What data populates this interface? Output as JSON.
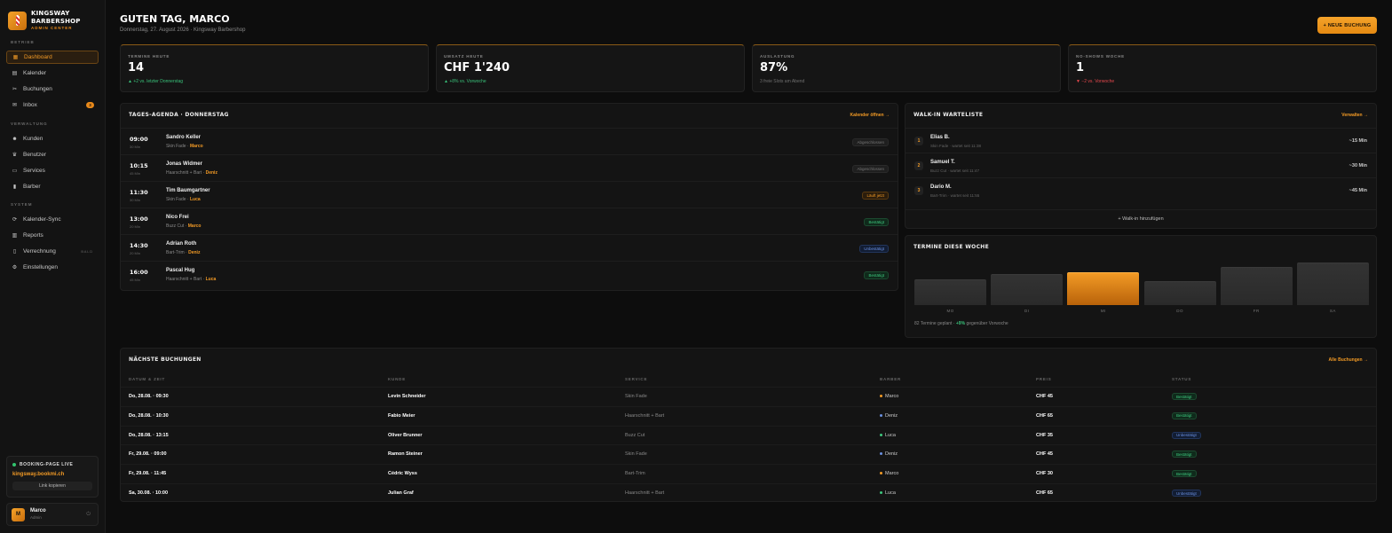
{
  "brand": {
    "name_line1": "KINGSWAY",
    "name_line2": "BARBERSHOP",
    "sub": "ADMIN CENTER"
  },
  "sidebar": {
    "sections": [
      {
        "label": "BETRIEB",
        "items": [
          {
            "label": "Dashboard",
            "icon": "grid-icon",
            "glyph": "▦",
            "active": true
          },
          {
            "label": "Kalender",
            "icon": "calendar-icon",
            "glyph": "▤"
          },
          {
            "label": "Buchungen",
            "icon": "scissors-icon",
            "glyph": "✂"
          },
          {
            "label": "Inbox",
            "icon": "inbox-icon",
            "glyph": "✉",
            "badge": "3"
          }
        ]
      },
      {
        "label": "VERWALTUNG",
        "items": [
          {
            "label": "Kunden",
            "icon": "user-icon",
            "glyph": "☻"
          },
          {
            "label": "Benutzer",
            "icon": "trophy-icon",
            "glyph": "♛"
          },
          {
            "label": "Services",
            "icon": "ticket-icon",
            "glyph": "▭"
          },
          {
            "label": "Barber",
            "icon": "barber-pole-icon",
            "glyph": "▮"
          }
        ]
      },
      {
        "label": "SYSTEM",
        "items": [
          {
            "label": "Kalender-Sync",
            "icon": "sync-icon",
            "glyph": "⟳"
          },
          {
            "label": "Reports",
            "icon": "chart-icon",
            "glyph": "▥"
          },
          {
            "label": "Verrechnung",
            "icon": "invoice-icon",
            "glyph": "▯",
            "tag": "BALD"
          },
          {
            "label": "Einstellungen",
            "icon": "gear-icon",
            "glyph": "⚙"
          }
        ]
      }
    ],
    "live": {
      "title": "BOOKING-PAGE LIVE",
      "url": "kingsway.bookmi.ch",
      "button": "Link kopieren"
    },
    "user": {
      "initial": "M",
      "name": "Marco",
      "role": "Admin"
    }
  },
  "header": {
    "greeting": "GUTEN TAG, MARCO",
    "subtitle": "Donnerstag, 27. August 2026 · Kingsway Barbershop",
    "new_button": "+ NEUE BUCHUNG"
  },
  "kpis": [
    {
      "label": "TERMINE HEUTE",
      "value": "14",
      "trend": "▲ +2 vs. letzter Donnerstag",
      "kind": "up"
    },
    {
      "label": "UMSATZ HEUTE",
      "value": "CHF 1'240",
      "trend": "▲ +8% vs. Vorwoche",
      "kind": "up"
    },
    {
      "label": "AUSLASTUNG",
      "value": "87%",
      "trend": "3 freie Slots am Abend",
      "kind": "muted"
    },
    {
      "label": "NO-SHOWS WOCHE",
      "value": "1",
      "trend": "▼ −2 vs. Vorwoche",
      "kind": "down"
    }
  ],
  "agenda": {
    "title": "TAGES-AGENDA · DONNERSTAG",
    "link": "Kalender öffnen →",
    "rows": [
      {
        "time": "09:00",
        "dur": "30 Min",
        "name": "Sandro Keller",
        "service": "Skin Fade",
        "barber": "Marco",
        "status": "Abgeschlossen",
        "kind": "done"
      },
      {
        "time": "10:15",
        "dur": "45 Min",
        "name": "Jonas Widmer",
        "service": "Haarschnitt + Bart",
        "barber": "Deniz",
        "status": "Abgeschlossen",
        "kind": "done"
      },
      {
        "time": "11:30",
        "dur": "30 Min",
        "name": "Tim Baumgartner",
        "service": "Skin Fade",
        "barber": "Luca",
        "status": "Läuft jetzt",
        "kind": "run"
      },
      {
        "time": "13:00",
        "dur": "20 Min",
        "name": "Nico Frei",
        "service": "Buzz Cut",
        "barber": "Marco",
        "status": "Bestätigt",
        "kind": "ok"
      },
      {
        "time": "14:30",
        "dur": "20 Min",
        "name": "Adrian Roth",
        "service": "Bart-Trim",
        "barber": "Deniz",
        "status": "Unbestätigt",
        "kind": "pend"
      },
      {
        "time": "16:00",
        "dur": "45 Min",
        "name": "Pascal Hug",
        "service": "Haarschnitt + Bart",
        "barber": "Luca",
        "status": "Bestätigt",
        "kind": "ok"
      }
    ]
  },
  "walkin": {
    "title": "WALK-IN WARTELISTE",
    "link": "Verwalten →",
    "rows": [
      {
        "num": "1",
        "name": "Elias B.",
        "sub": "Skin Fade · wartet seit 11:38",
        "wait": "~15 Min"
      },
      {
        "num": "2",
        "name": "Samuel T.",
        "sub": "Buzz Cut · wartet seit 11:47",
        "wait": "~30 Min"
      },
      {
        "num": "3",
        "name": "Dario M.",
        "sub": "Bart-Trim · wartet seit 11:55",
        "wait": "~45 Min"
      }
    ],
    "add": "+ Walk-in hinzufügen"
  },
  "week": {
    "title": "TERMINE DIESE WOCHE",
    "foot_prefix": "82 Termine geplant ·",
    "foot_delta": "+9%",
    "foot_suffix": "gegenüber Vorwoche",
    "highlight": "MI"
  },
  "chart_data": {
    "type": "bar",
    "categories": [
      "MO",
      "DI",
      "MI",
      "DO",
      "FR",
      "SA"
    ],
    "values": [
      11,
      13,
      14,
      10,
      16,
      18
    ],
    "ylim": [
      0,
      18
    ]
  },
  "bookings": {
    "title": "NÄCHSTE BUCHUNGEN",
    "link": "Alle Buchungen →",
    "columns": [
      "DATUM & ZEIT",
      "KUNDE",
      "SERVICE",
      "BARBER",
      "PREIS",
      "STATUS"
    ],
    "barber_colors": {
      "Marco": "#f29a25",
      "Deniz": "#6a90e0",
      "Luca": "#3ec77e"
    },
    "rows": [
      {
        "date": "Do, 28.08. · 09:30",
        "client": "Levin Schneider",
        "service": "Skin Fade",
        "barber": "Marco",
        "price": "CHF 45",
        "status": "Bestätigt",
        "kind": "ok"
      },
      {
        "date": "Do, 28.08. · 10:30",
        "client": "Fabio Meier",
        "service": "Haarschnitt + Bart",
        "barber": "Deniz",
        "price": "CHF 65",
        "status": "Bestätigt",
        "kind": "ok"
      },
      {
        "date": "Do, 28.08. · 13:15",
        "client": "Oliver Brunner",
        "service": "Buzz Cut",
        "barber": "Luca",
        "price": "CHF 35",
        "status": "Unbestätigt",
        "kind": "pend"
      },
      {
        "date": "Fr, 29.08. · 09:00",
        "client": "Ramon Steiner",
        "service": "Skin Fade",
        "barber": "Deniz",
        "price": "CHF 45",
        "status": "Bestätigt",
        "kind": "ok"
      },
      {
        "date": "Fr, 29.08. · 11:45",
        "client": "Cédric Wyss",
        "service": "Bart-Trim",
        "barber": "Marco",
        "price": "CHF 30",
        "status": "Bestätigt",
        "kind": "ok"
      },
      {
        "date": "Sa, 30.08. · 10:00",
        "client": "Julian Graf",
        "service": "Haarschnitt + Bart",
        "barber": "Luca",
        "price": "CHF 65",
        "status": "Unbestätigt",
        "kind": "pend"
      }
    ]
  }
}
